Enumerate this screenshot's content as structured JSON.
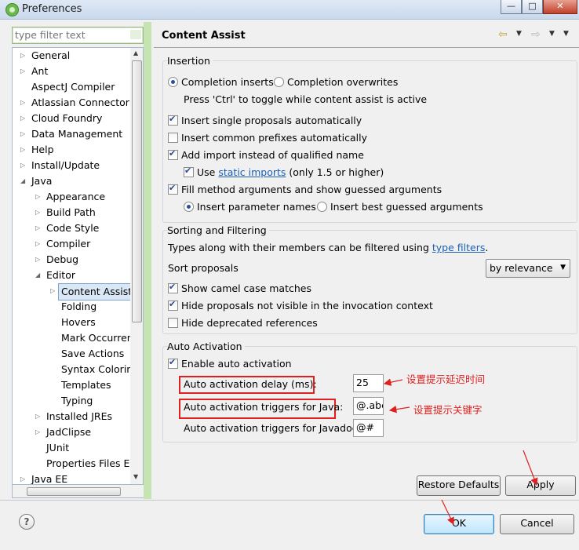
{
  "window": {
    "title": "Preferences",
    "controls": {
      "minimize": "—",
      "maximize": "□",
      "close": "✕"
    }
  },
  "filter": {
    "placeholder": "type filter text",
    "value": ""
  },
  "tree": [
    {
      "label": "General",
      "level": 0,
      "arrow": "▷"
    },
    {
      "label": "Ant",
      "level": 0,
      "arrow": "▷"
    },
    {
      "label": "AspectJ Compiler",
      "level": 0,
      "arrow": ""
    },
    {
      "label": "Atlassian Connector",
      "level": 0,
      "arrow": "▷"
    },
    {
      "label": "Cloud Foundry",
      "level": 0,
      "arrow": "▷"
    },
    {
      "label": "Data Management",
      "level": 0,
      "arrow": "▷"
    },
    {
      "label": "Help",
      "level": 0,
      "arrow": "▷"
    },
    {
      "label": "Install/Update",
      "level": 0,
      "arrow": "▷"
    },
    {
      "label": "Java",
      "level": 0,
      "arrow": "◢"
    },
    {
      "label": "Appearance",
      "level": 1,
      "arrow": "▷"
    },
    {
      "label": "Build Path",
      "level": 1,
      "arrow": "▷"
    },
    {
      "label": "Code Style",
      "level": 1,
      "arrow": "▷"
    },
    {
      "label": "Compiler",
      "level": 1,
      "arrow": "▷"
    },
    {
      "label": "Debug",
      "level": 1,
      "arrow": "▷"
    },
    {
      "label": "Editor",
      "level": 1,
      "arrow": "◢"
    },
    {
      "label": "Content Assist",
      "level": 2,
      "arrow": "▷",
      "selected": true
    },
    {
      "label": "Folding",
      "level": 2,
      "arrow": ""
    },
    {
      "label": "Hovers",
      "level": 2,
      "arrow": ""
    },
    {
      "label": "Mark Occurrences",
      "level": 2,
      "arrow": ""
    },
    {
      "label": "Save Actions",
      "level": 2,
      "arrow": ""
    },
    {
      "label": "Syntax Coloring",
      "level": 2,
      "arrow": ""
    },
    {
      "label": "Templates",
      "level": 2,
      "arrow": ""
    },
    {
      "label": "Typing",
      "level": 2,
      "arrow": ""
    },
    {
      "label": "Installed JREs",
      "level": 1,
      "arrow": "▷"
    },
    {
      "label": "JadClipse",
      "level": 1,
      "arrow": "▷"
    },
    {
      "label": "JUnit",
      "level": 1,
      "arrow": ""
    },
    {
      "label": "Properties Files Editor",
      "level": 1,
      "arrow": ""
    },
    {
      "label": "Java EE",
      "level": 0,
      "arrow": "▷"
    }
  ],
  "page": {
    "title": "Content Assist",
    "nav": {
      "back_icon": "⇦",
      "forward_icon": "⇨",
      "dropdown_icon": "▼",
      "menu_icon": "▼"
    }
  },
  "insertion": {
    "title": "Insertion",
    "completion_inserts": "Completion inserts",
    "completion_overwrites": "Completion overwrites",
    "toggle_hint": "Press 'Ctrl' to toggle while content assist is active",
    "single_proposals": "Insert single proposals automatically",
    "common_prefixes": "Insert common prefixes automatically",
    "add_import": "Add import instead of qualified name",
    "use_label": "Use",
    "static_imports_link": "static imports",
    "static_imports_suffix": "(only 1.5 or higher)",
    "fill_method_args": "Fill method arguments and show guessed arguments",
    "insert_param_names": "Insert parameter names",
    "insert_best_guessed": "Insert best guessed arguments"
  },
  "sorting": {
    "title": "Sorting and Filtering",
    "types_prefix": "Types along with their members can be filtered using",
    "type_filters_link": "type filters",
    "types_suffix": ".",
    "sort_label": "Sort proposals",
    "sort_value": "by relevance",
    "camel_case": "Show camel case matches",
    "hide_not_visible": "Hide proposals not visible in the invocation context",
    "hide_deprecated": "Hide deprecated references"
  },
  "auto_activation": {
    "title": "Auto Activation",
    "enable": "Enable auto activation",
    "delay_label": "Auto activation delay (ms):",
    "delay_value": "25",
    "java_label": "Auto activation triggers for Java:",
    "java_value": "@.abc",
    "javadoc_label": "Auto activation triggers for Javadoc:",
    "javadoc_value": "@#"
  },
  "annotations": {
    "delay_note": "设置提示延迟时间",
    "keyword_note": "设置提示关键字"
  },
  "buttons": {
    "restore_defaults": "Restore Defaults",
    "apply": "Apply",
    "ok": "OK",
    "cancel": "Cancel",
    "help": "?"
  },
  "colors": {
    "annotation": "#e02020",
    "link": "#1a5fb4",
    "divider": "#c6e3b2"
  }
}
